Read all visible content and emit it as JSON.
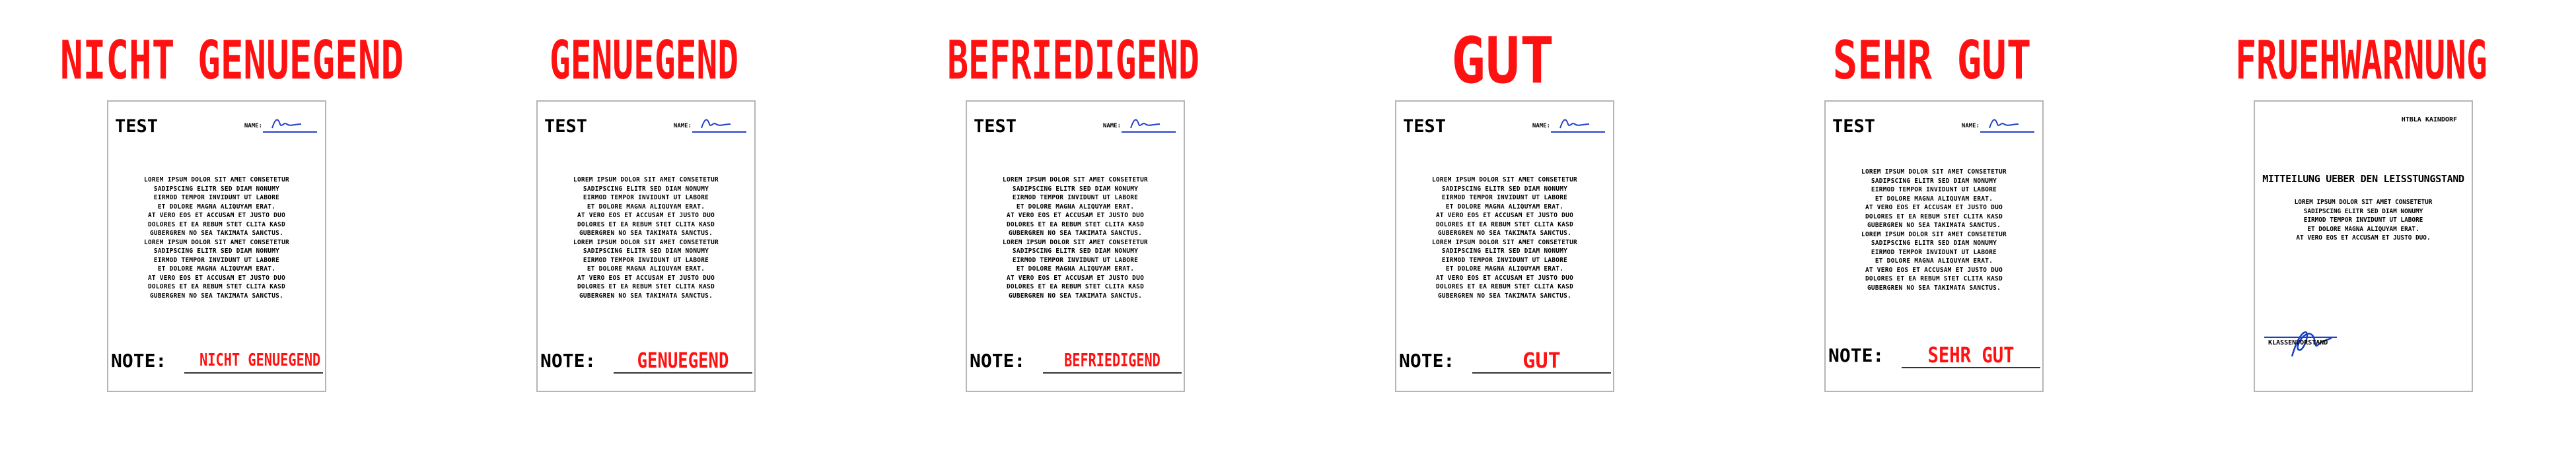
{
  "panels": [
    {
      "title": "NICHT GENUEGEND",
      "test_label": "TEST",
      "name_label": "NAME:",
      "body": "LOREM IPSUM DOLOR SIT AMET CONSETETUR\nSADIPSCING ELITR SED DIAM NONUMY\nEIRMOD TEMPOR INVIDUNT UT LABORE\nET DOLORE MAGNA ALIQUYAM ERAT.\nAT VERO EOS ET ACCUSAM ET JUSTO DUO\nDOLORES ET EA REBUM STET CLITA KASD\nGUBERGREN NO SEA TAKIMATA SANCTUS.\nLOREM IPSUM DOLOR SIT AMET CONSETETUR\nSADIPSCING ELITR SED DIAM NONUMY\nEIRMOD TEMPOR INVIDUNT UT LABORE\nET DOLORE MAGNA ALIQUYAM ERAT.\nAT VERO EOS ET ACCUSAM ET JUSTO DUO\nDOLORES ET EA REBUM STET CLITA KASD\nGUBERGREN NO SEA TAKIMATA SANCTUS.",
      "note_label": "NOTE:",
      "note_value": "NICHT GENUEGEND"
    },
    {
      "title": "GENUEGEND",
      "test_label": "TEST",
      "name_label": "NAME:",
      "body": "LOREM IPSUM DOLOR SIT AMET CONSETETUR\nSADIPSCING ELITR SED DIAM NONUMY\nEIRMOD TEMPOR INVIDUNT UT LABORE\nET DOLORE MAGNA ALIQUYAM ERAT.\nAT VERO EOS ET ACCUSAM ET JUSTO DUO\nDOLORES ET EA REBUM STET CLITA KASD\nGUBERGREN NO SEA TAKIMATA SANCTUS.\nLOREM IPSUM DOLOR SIT AMET CONSETETUR\nSADIPSCING ELITR SED DIAM NONUMY\nEIRMOD TEMPOR INVIDUNT UT LABORE\nET DOLORE MAGNA ALIQUYAM ERAT.\nAT VERO EOS ET ACCUSAM ET JUSTO DUO\nDOLORES ET EA REBUM STET CLITA KASD\nGUBERGREN NO SEA TAKIMATA SANCTUS.",
      "note_label": "NOTE:",
      "note_value": "GENUEGEND"
    },
    {
      "title": "BEFRIEDIGEND",
      "test_label": "TEST",
      "name_label": "NAME:",
      "body": "LOREM IPSUM DOLOR SIT AMET CONSETETUR\nSADIPSCING ELITR SED DIAM NONUMY\nEIRMOD TEMPOR INVIDUNT UT LABORE\nET DOLORE MAGNA ALIQUYAM ERAT.\nAT VERO EOS ET ACCUSAM ET JUSTO DUO\nDOLORES ET EA REBUM STET CLITA KASD\nGUBERGREN NO SEA TAKIMATA SANCTUS.\nLOREM IPSUM DOLOR SIT AMET CONSETETUR\nSADIPSCING ELITR SED DIAM NONUMY\nEIRMOD TEMPOR INVIDUNT UT LABORE\nET DOLORE MAGNA ALIQUYAM ERAT.\nAT VERO EOS ET ACCUSAM ET JUSTO DUO\nDOLORES ET EA REBUM STET CLITA KASD\nGUBERGREN NO SEA TAKIMATA SANCTUS.",
      "note_label": "NOTE:",
      "note_value": "BEFRIEDIGEND"
    },
    {
      "title": "GUT",
      "test_label": "TEST",
      "name_label": "NAME:",
      "body": "LOREM IPSUM DOLOR SIT AMET CONSETETUR\nSADIPSCING ELITR SED DIAM NONUMY\nEIRMOD TEMPOR INVIDUNT UT LABORE\nET DOLORE MAGNA ALIQUYAM ERAT.\nAT VERO EOS ET ACCUSAM ET JUSTO DUO\nDOLORES ET EA REBUM STET CLITA KASD\nGUBERGREN NO SEA TAKIMATA SANCTUS.\nLOREM IPSUM DOLOR SIT AMET CONSETETUR\nSADIPSCING ELITR SED DIAM NONUMY\nEIRMOD TEMPOR INVIDUNT UT LABORE\nET DOLORE MAGNA ALIQUYAM ERAT.\nAT VERO EOS ET ACCUSAM ET JUSTO DUO\nDOLORES ET EA REBUM STET CLITA KASD\nGUBERGREN NO SEA TAKIMATA SANCTUS.",
      "note_label": "NOTE:",
      "note_value": "GUT"
    },
    {
      "title": "SEHR GUT",
      "test_label": "TEST",
      "name_label": "NAME:",
      "body": "LOREM IPSUM DOLOR SIT AMET CONSETETUR\nSADIPSCING ELITR SED DIAM NONUMY\nEIRMOD TEMPOR INVIDUNT UT LABORE\nET DOLORE MAGNA ALIQUYAM ERAT.\nAT VERO EOS ET ACCUSAM ET JUSTO DUO\nDOLORES ET EA REBUM STET CLITA KASD\nGUBERGREN NO SEA TAKIMATA SANCTUS.\nLOREM IPSUM DOLOR SIT AMET CONSETETUR\nSADIPSCING ELITR SED DIAM NONUMY\nEIRMOD TEMPOR INVIDUNT UT LABORE\nET DOLORE MAGNA ALIQUYAM ERAT.\nAT VERO EOS ET ACCUSAM ET JUSTO DUO\nDOLORES ET EA REBUM STET CLITA KASD\nGUBERGREN NO SEA TAKIMATA SANCTUS.",
      "note_label": "NOTE:",
      "note_value": "SEHR GUT"
    }
  ],
  "warning": {
    "title": "FRUEHWARNUNG",
    "top_text": "HTBLA KAINDORF",
    "heading": "MITTEILUNG UEBER DEN LEISSTUNGSTAND",
    "body": "LOREM IPSUM DOLOR SIT AMET CONSETETUR\nSADIPSCING ELITR SED DIAM NONUMY\nEIRMOD TEMPOR INVIDUNT UT LABORE\nET DOLORE MAGNA ALIQUYAM ERAT.\nAT VERO EOS ET ACCUSAM ET JUSTO DUO.",
    "sign_label": "KLASSENVORSTAND"
  },
  "colors": {
    "accent": "#ff1111",
    "ink": "#000000",
    "signature": "#1a3fc4",
    "sheet_border": "#b5b5b5"
  }
}
